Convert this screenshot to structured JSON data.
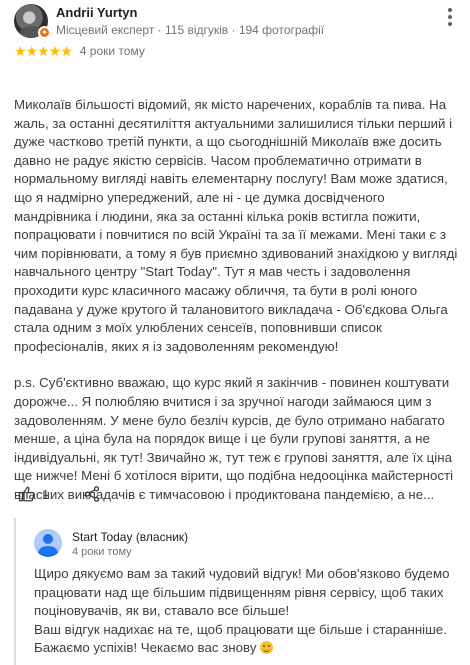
{
  "review": {
    "author": "Andrii Yurtyn",
    "meta": "Місцевий експерт · 115 відгуків · 194 фотографії",
    "stars": "★★★★★",
    "time": "4 роки тому",
    "paragraphs": [
      "Миколаїв більшості відомий, як місто наречених, кораблів та пива. На жаль, за останні десятиліття актуальними залишилися тільки перший і дуже частково третій пункти, а що сьогоднішній Миколаїв вже досить давно не радує якістю сервісів. Часом проблематично отримати в нормальному вигляді навіть елементарну послугу! Вам може здатися, що я надмірно упереджений, але ні - це думка досвідченого мандрівника і людини, яка за останні кілька років встигла пожити, попрацювати і повчитися по всій Україні та за її межами. Мені таки є з чим порівнювати, а тому я був приємно здивований знахідкою у вигляді навчального центру \"Start Today\". Тут я мав честь і задоволення проходити курс класичного масажу обличчя, та бути в ролі юного падавана у дуже крутого й талановитого викладача - Об'єдкова Ольга стала одним з моїх улюблених сенсеїв, поповнивши список професіоналів, яких я із задоволенням рекомендую!",
      "p.s. Суб'єктивно вважаю, що курс який я закінчив - повинен коштувати дорожче... Я полюбляю вчитися і за зручної нагоди займаюся цим з задоволенням. У мене було безліч курсів, де було отримано набагато менше, а ціна була на порядок вище і це були групові заняття, а не індивідуальні, як тут! Звичайно ж, тут теж є групові заняття, але їх ціна ще нижче! Мені б хотілося вірити, що подібна недооцінка майстерності власних викладачів є тимчасовою і продиктована пандемією, а не..."
    ],
    "likes": "1"
  },
  "reply": {
    "owner": "Start Today (власник)",
    "time": "4 роки тому",
    "text": "Щиро дякуємо вам за такий чудовий відгук! Ми обов'язково будемо працювати над ще більшим підвищенням рівня сервісу, щоб таких поціновувачів, як ви, ставало все більше!\nВаш відгук надихає на те, щоб працювати ще більше і старанніше. Бажаємо успіхів! Чекаємо вас знову"
  },
  "colors": {
    "star": "#fbbc04",
    "badge": "#e8710a",
    "owner_avatar": "#1a73e8"
  },
  "icons": [
    "more-vert-icon",
    "thumb-up-icon",
    "share-icon",
    "local-guide-badge-icon",
    "smiley-icon"
  ]
}
